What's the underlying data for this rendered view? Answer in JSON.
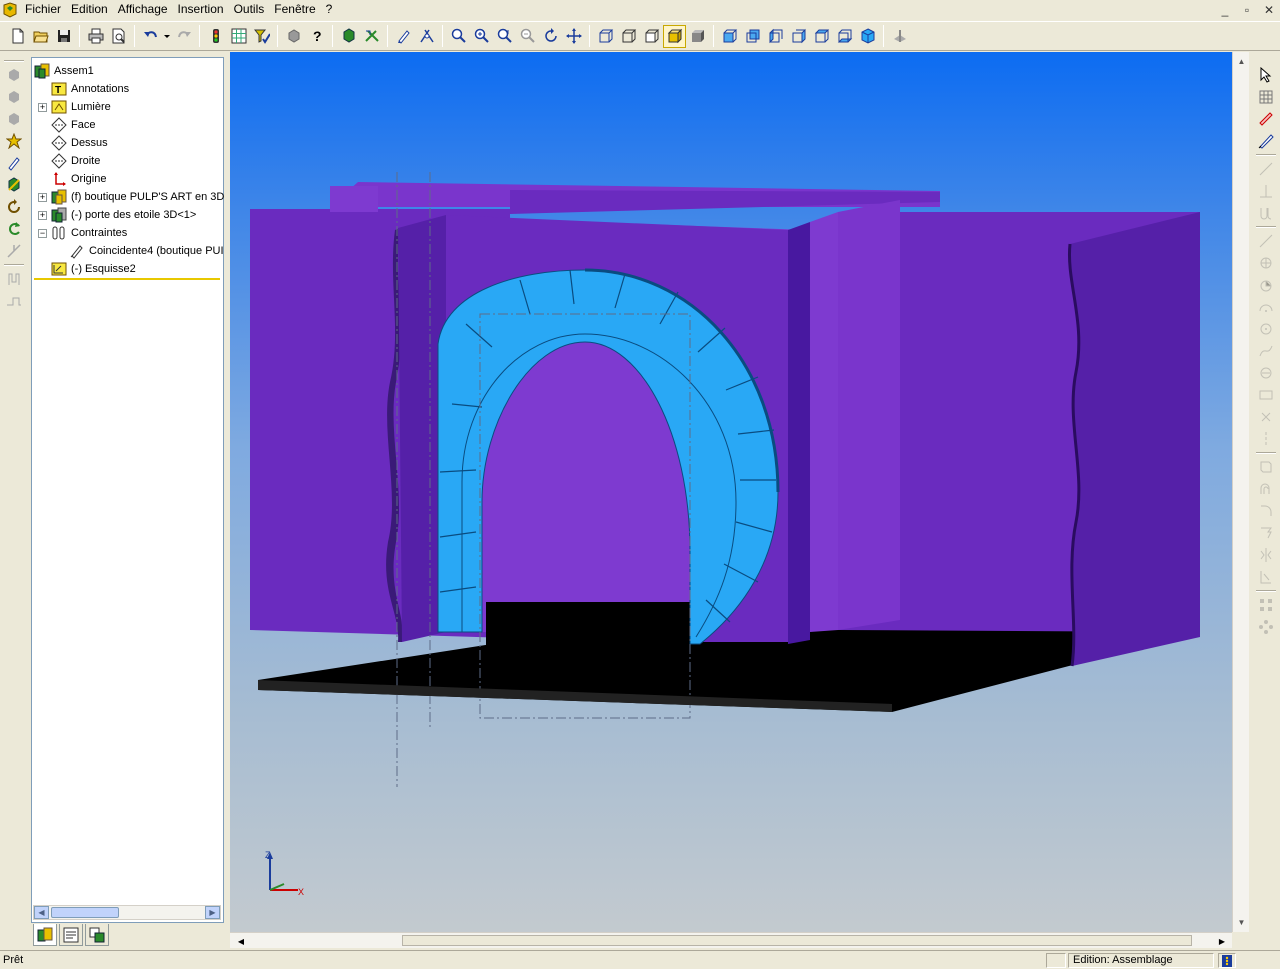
{
  "menu": {
    "items": [
      "Fichier",
      "Edition",
      "Affichage",
      "Insertion",
      "Outils",
      "Fenêtre",
      "?"
    ]
  },
  "window_controls": {
    "minimize": "_",
    "restore": "▫",
    "close": "✕"
  },
  "toolbar": {
    "icons": [
      "new-document-icon",
      "open-folder-icon",
      "save-icon",
      "print-icon",
      "print-preview-icon",
      "undo-icon",
      "redo-icon",
      "traffic-light-icon",
      "grid-icon",
      "select-filter-icon",
      "component-icon",
      "help-icon",
      "move-component-icon",
      "rotate-component-icon",
      "pencil-icon",
      "smart-mate-icon",
      "zoom-fit-icon",
      "zoom-window-icon",
      "zoom-in-out-icon",
      "zoom-selection-icon",
      "rotate-view-icon",
      "pan-icon",
      "wireframe-icon",
      "hidden-lines-visible-icon",
      "hidden-lines-removed-icon",
      "shaded-edges-icon",
      "shaded-icon",
      "view-front-icon",
      "view-back-icon",
      "view-left-icon",
      "view-right-icon",
      "view-top-icon",
      "view-isometric-icon",
      "section-view-icon"
    ]
  },
  "feature_tree": {
    "root": "Assem1",
    "items": [
      {
        "label": "Annotations",
        "expander": ""
      },
      {
        "label": "Lumière",
        "expander": "+"
      },
      {
        "label": "Face",
        "expander": ""
      },
      {
        "label": "Dessus",
        "expander": ""
      },
      {
        "label": "Droite",
        "expander": ""
      },
      {
        "label": "Origine",
        "expander": ""
      },
      {
        "label": "(f) boutique PULP'S ART en 3D",
        "expander": "+"
      },
      {
        "label": "(-) porte des etoile 3D<1>",
        "expander": "+"
      },
      {
        "label": "Contraintes",
        "expander": "−"
      },
      {
        "label": "Coincidente4 (boutique PUI",
        "expander": ""
      },
      {
        "label": "(-) Esquisse2",
        "expander": ""
      }
    ]
  },
  "triad": {
    "z_label": "Z",
    "x_label": "X"
  },
  "status": {
    "left": "Prêt",
    "mode": "Edition: Assemblage"
  },
  "colors": {
    "background_top": "#0c6cf2",
    "background_bottom": "#c3cacf",
    "wall": "#6a2bbf",
    "gate": "#29a8f5",
    "floor": "#000000"
  }
}
